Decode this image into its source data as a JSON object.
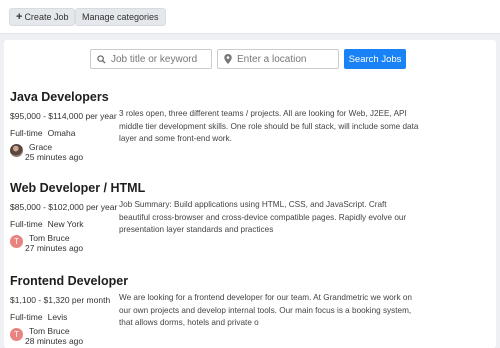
{
  "toolbar": {
    "create_label": "Create Job",
    "manage_label": "Manage categories"
  },
  "search": {
    "keyword_placeholder": "Job title or keyword",
    "location_placeholder": "Enter a location",
    "button_label": "Search Jobs",
    "button_color": "#1a82f7"
  },
  "jobs": [
    {
      "title": "Java Developers",
      "salary": "$95,000 - $114,000 per year",
      "type": "Full-time",
      "location": "Omaha",
      "description": "3 roles open, three different teams / projects. All are looking for Web, J2EE, API middle tier development skills. One role should be full stack, will include some data layer and some front-end work.",
      "author": "Grace",
      "time": "25 minutes ago",
      "avatar": "photo"
    },
    {
      "title": "Web Developer / HTML",
      "salary": "$85,000 - $102,000 per year",
      "type": "Full-time",
      "location": "New York",
      "description": "Job Summary: Build applications using HTML, CSS, and JavaScript. Craft beautiful cross-browser and cross-device compatible pages. Rapidly evolve our presentation layer standards and practices",
      "author": "Tom Bruce",
      "time": "27 minutes ago",
      "avatar_letter": "T"
    },
    {
      "title": "Frontend Developer",
      "salary": "$1,100 - $1,320 per month",
      "type": "Full-time",
      "location": "Levis",
      "description": "We are looking for a frontend developer for our team. At Grandmetric we work on our own projects and develop internal tools. Our main focus is a booking system, that allows dorms, hotels and private o",
      "author": "Tom Bruce",
      "time": "28 minutes ago",
      "avatar_letter": "T"
    }
  ]
}
